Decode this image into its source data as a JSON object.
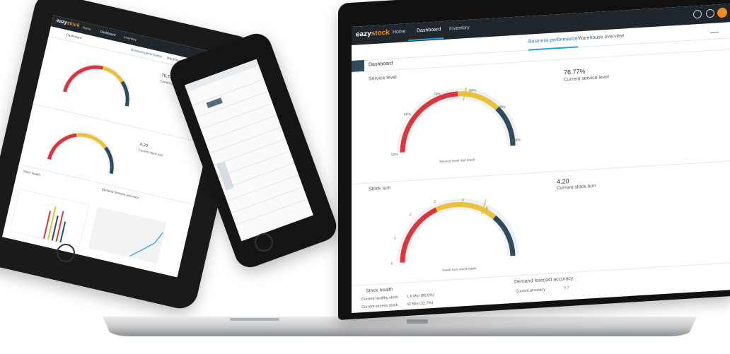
{
  "colors": {
    "topbar": "#20272c",
    "accent": "#f28a1e",
    "tab_active": "#2a9fd6",
    "gauge_red": "#d9363e",
    "gauge_yellow": "#e8c23a",
    "gauge_navy": "#2f4a5c",
    "gauge_track": "#eef0f2"
  },
  "app": {
    "logo_prefix": "eazy",
    "logo_suffix": "stock",
    "nav": {
      "home": "Home",
      "dashboard": "Dashboard",
      "inventory": "Inventory"
    },
    "tabs": {
      "business": "Business performance",
      "warehouse": "Warehouse overview"
    },
    "page_title": "Dashboard"
  },
  "service_level": {
    "section_label": "Service level",
    "kpi_value": "76.77%",
    "kpi_label": "Current service level",
    "gauge_caption": "Service level last week",
    "gauge_value_fraction": 0.7677,
    "ticks": [
      "50%",
      "60%",
      "70%",
      "80%",
      "90%",
      "100%"
    ]
  },
  "stock_turn": {
    "section_label": "Stock turn",
    "kpi_value": "4.20",
    "kpi_label": "Current stock turn",
    "gauge_caption": "Stock turn since week",
    "gauge_value": 4.2,
    "ticks": [
      "0",
      "1",
      "2",
      "3",
      "4",
      "5",
      "6",
      "7"
    ]
  },
  "stock_health": {
    "section_label": "Stock health",
    "rows": [
      {
        "label": "Current healthy stock",
        "value": "1.6 Mio (85.8%)"
      },
      {
        "label": "Current excess stock",
        "value": "42 Mio (32.7%)"
      }
    ]
  },
  "demand_forecast": {
    "section_label": "Demand forecast accuracy",
    "rows": [
      {
        "label": "Current accuracy",
        "value": "7.7"
      }
    ]
  },
  "tablet": {
    "kpi_service": "76.77%",
    "kpi_service_label": "Current service level",
    "kpi_stock": "4.20",
    "kpi_stock_label": "Current stock turn",
    "stock_health": "Stock health",
    "demand_forecast": "Demand forecast accuracy"
  }
}
